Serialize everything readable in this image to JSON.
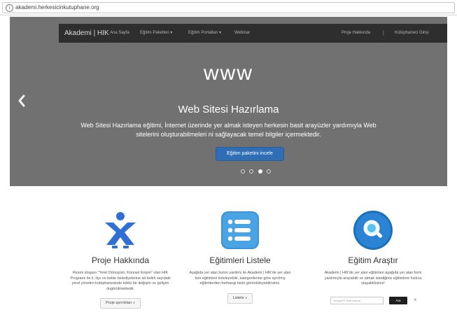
{
  "address_bar": {
    "url": "akademi.herkesicinkutuphane.org"
  },
  "navbar": {
    "brand": "Akademi | HIK",
    "left_items": [
      "Ana Sayfa",
      "Eğitim Paketleri ▾",
      "Eğitim Portalları ▾",
      "Webinar"
    ],
    "right_items": [
      "Proje Hakkında",
      "Kütüphaneci Girişi"
    ],
    "separator": "|"
  },
  "carousel": {
    "icon_text": "www",
    "title": "Web Sitesi Hazırlama",
    "description": "Web Sitesi Hazırlama eğitimi, İnternet üzerinde yer almak isteyen herkesin basit arayüzler yardımıyla Web sitelerini oluşturabilmeleri ni sağlayacak temel bilgiler içermektedir.",
    "button_label": "Eğitim paketini incele",
    "dot_count": 4,
    "active_dot": 3
  },
  "columns": [
    {
      "icon": "person-figure-icon",
      "title": "Proje Hakkında",
      "text": "Resmi sloganı \"Yerel Dönüşüm, Küresel Erişim\" olan HIK Programı ile il, ilçe ve belde belediyelerine ait belirli sayıdaki yerel yönetim kütüphanesinde köklü bir değişim ve gelişim öngörülmektedir.",
      "button_label": "Proje ayrıntıları »"
    },
    {
      "icon": "list-icon",
      "title": "Eğitimleri Listele",
      "text": "Aşağıda yer alan buton yardımı ile Akademi | HIK'de yer alan tüm eğitimleri listeleyebilir, kategorilerine göre ayrılmış eğitimlerden herhangi birini görüntüleyebilirsiniz.",
      "button_label": "Listele »"
    },
    {
      "icon": "search-magnifier-icon",
      "title": "Eğitim Araştır",
      "text": "Akademi | HIK'de yer alan eğitimleri aşağıda yer alan form yardımıyla arayabilir ve almak istediğiniz eğitimlere hızlıca ulaşabilirsiniz!",
      "search_placeholder": "Google™ Özel Arama",
      "search_button": "Ara",
      "close_symbol": "×"
    }
  ],
  "colors": {
    "hero_bg": "#717171",
    "navbar_bg": "#2e2e2e",
    "primary_button": "#2f6db5",
    "person_icon": "#2f6fd3",
    "list_icon": "#3c93d6",
    "search_icon": "#1b6fbf"
  }
}
